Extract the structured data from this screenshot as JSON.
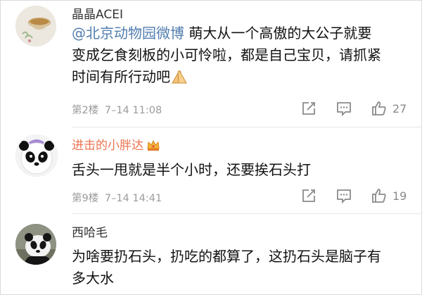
{
  "comments": [
    {
      "username": "晶晶ACEI",
      "mention": "@北京动物园微博",
      "text_line1_rest": " 萌大从一个高傲的大公子就要",
      "text_line2": "变成乞食刻板的小可怜啦，都是自己宝贝，请抓紧",
      "text_line3": "时间有所行动吧",
      "emoji": "palms-together-emoji",
      "floor": "第2楼",
      "time": "7–14 11:08",
      "likes": "27"
    },
    {
      "username": "进击的小胖达",
      "badge": "crown-badge-icon",
      "text_line1": "舌头一甩就是半个小时，还要挨石头打",
      "floor": "第9楼",
      "time": "7–14 14:41",
      "likes": "19"
    },
    {
      "username": "西哈毛",
      "text_line1": "为啥要扔石头，扔吃的都算了，这扔石头是脑子有",
      "text_line2": "多大水"
    }
  ],
  "icons": {
    "repost": "repost-icon",
    "comment": "comment-icon",
    "like": "like-icon"
  },
  "colors": {
    "mention": "#507daf",
    "vip_name": "#eb7350",
    "meta": "#9b9b9b"
  }
}
